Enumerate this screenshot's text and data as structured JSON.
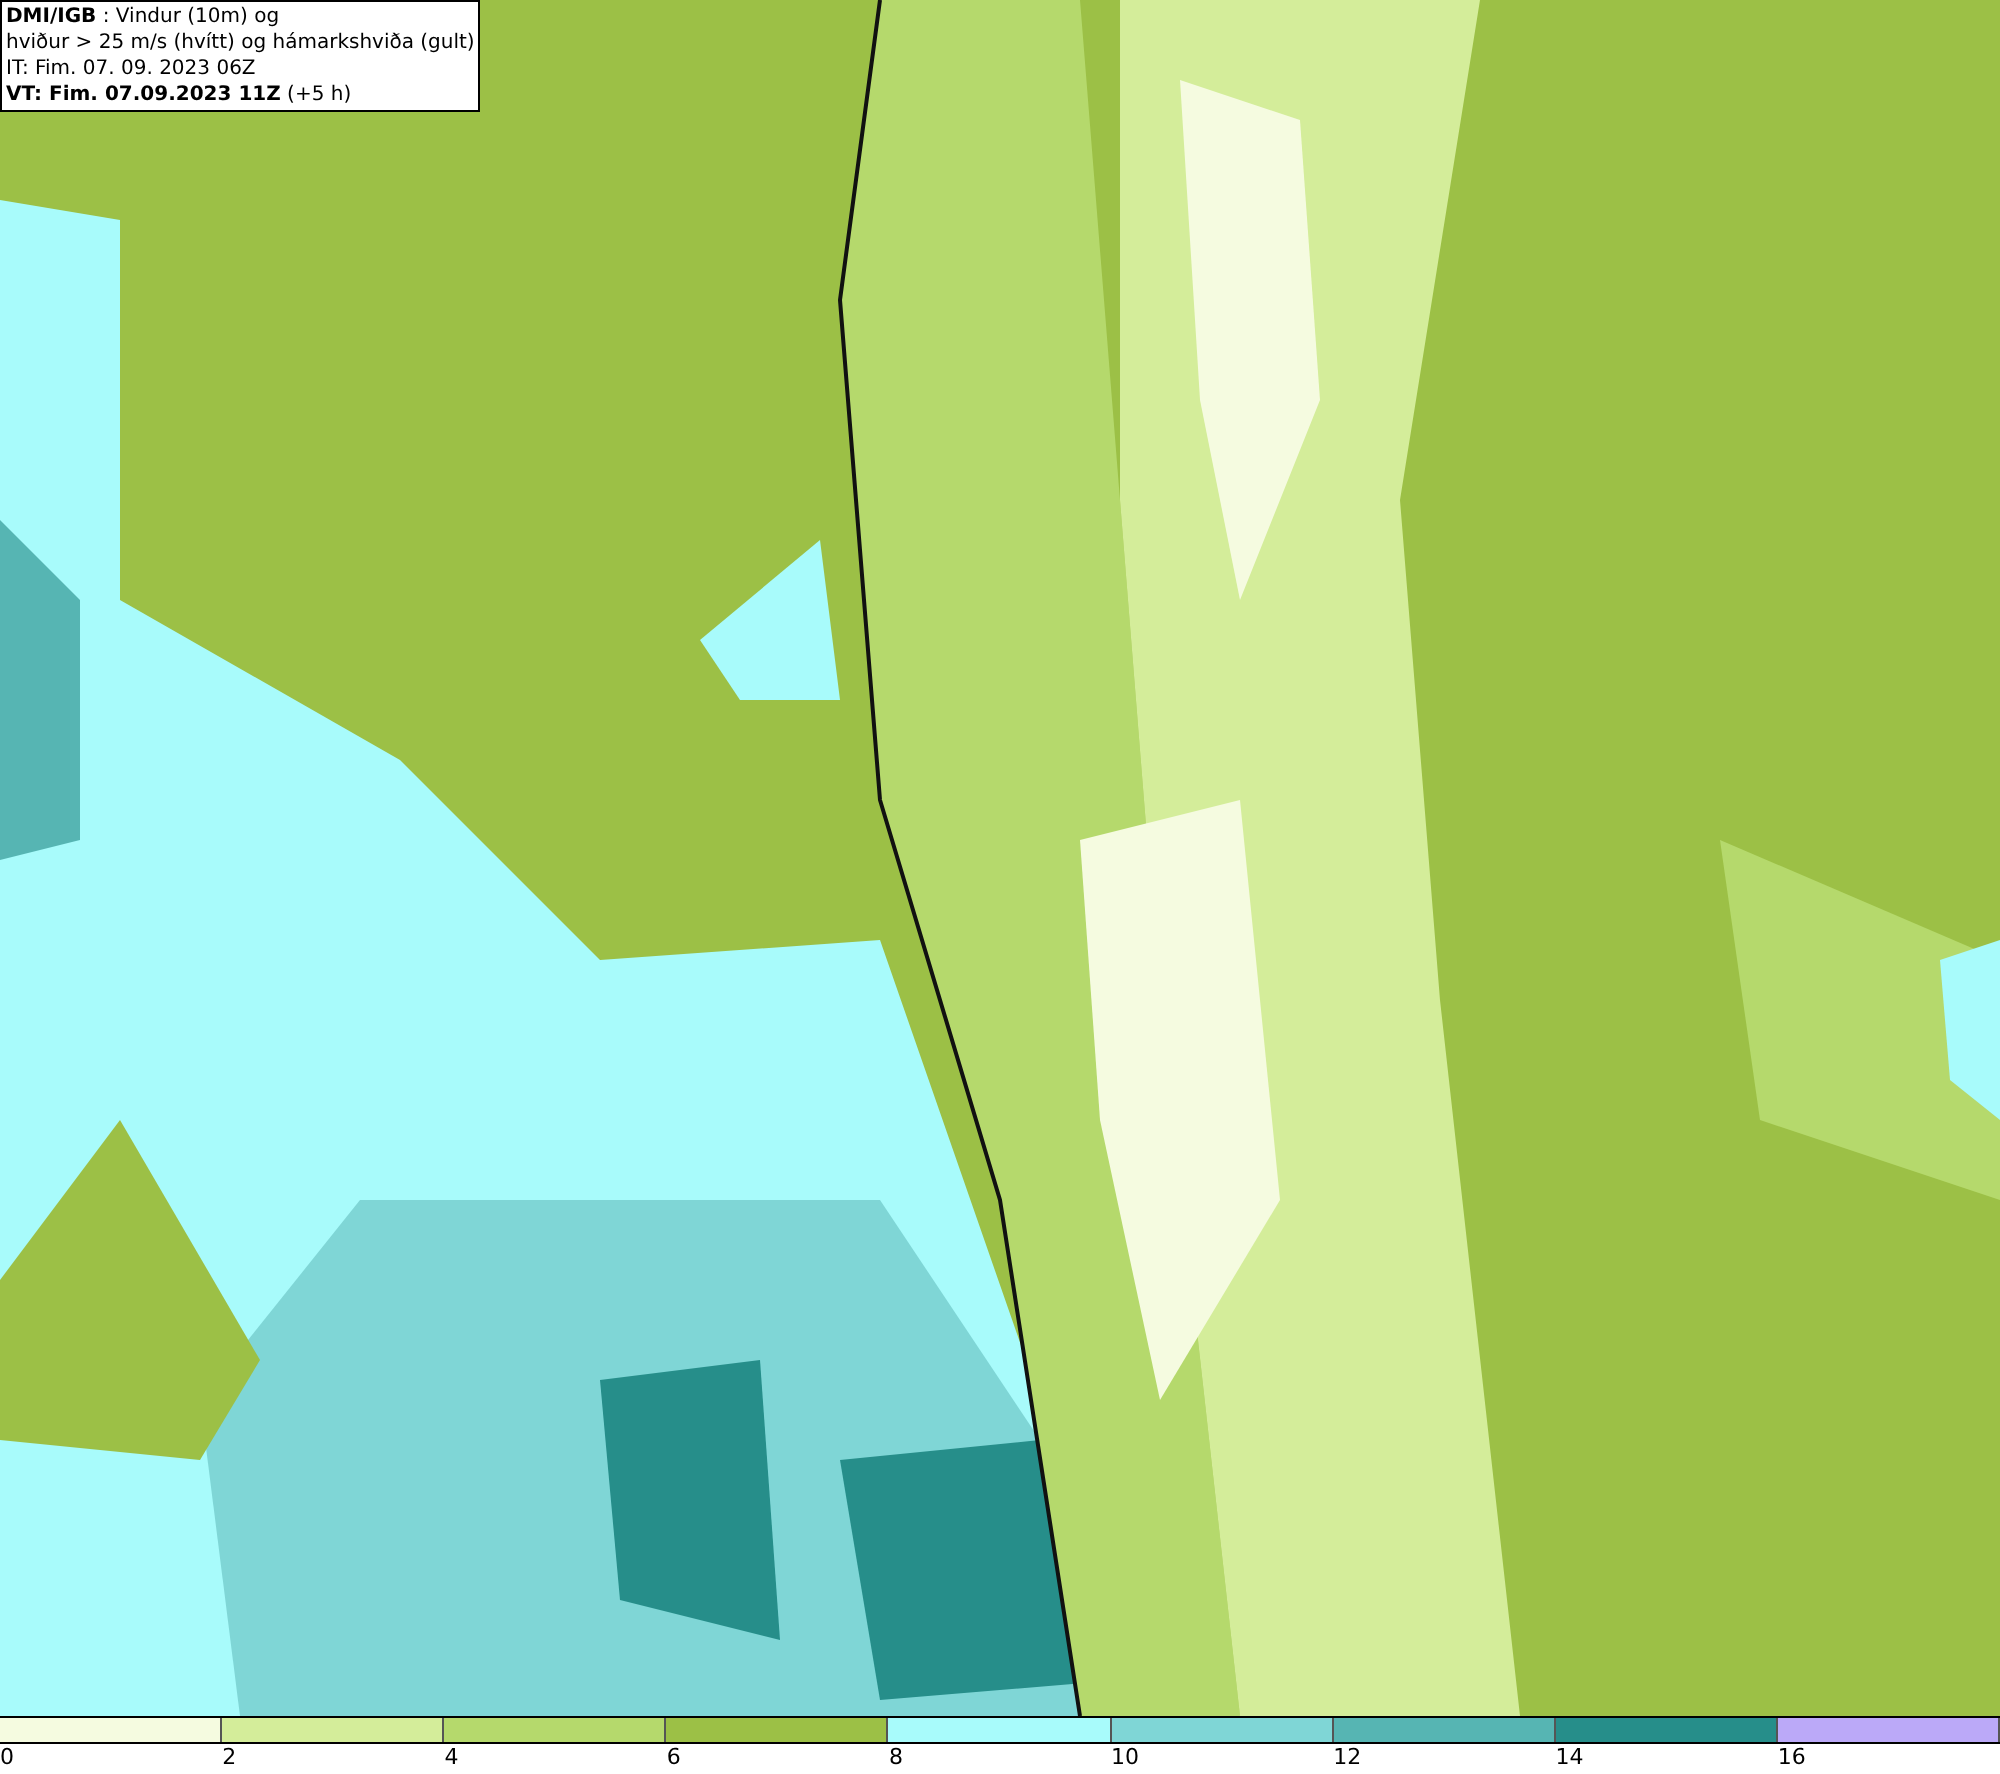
{
  "header": {
    "lines": [
      "**DMI/IGB** : Vindur (10m) og",
      "hviður > 25 m/s (hvítt) og hámarkshviða (gult)",
      "IT: Fim. 07. 09. 2023 06Z",
      "**VT: Fim. 07.09.2023 11Z** (+5 h)"
    ]
  },
  "legend": [
    {
      "label": "0",
      "color": "#f5fbe0"
    },
    {
      "label": "2",
      "color": "#d4ed9a"
    },
    {
      "label": "4",
      "color": "#b5d96c"
    },
    {
      "label": "6",
      "color": "#9cc046"
    },
    {
      "label": "8",
      "color": "#a8fbfb"
    },
    {
      "label": "10",
      "color": "#7fd6d6"
    },
    {
      "label": "12",
      "color": "#56b5b3"
    },
    {
      "label": "14",
      "color": "#268e8a"
    },
    {
      "label": "16",
      "color": "#bba9f8"
    }
  ]
}
